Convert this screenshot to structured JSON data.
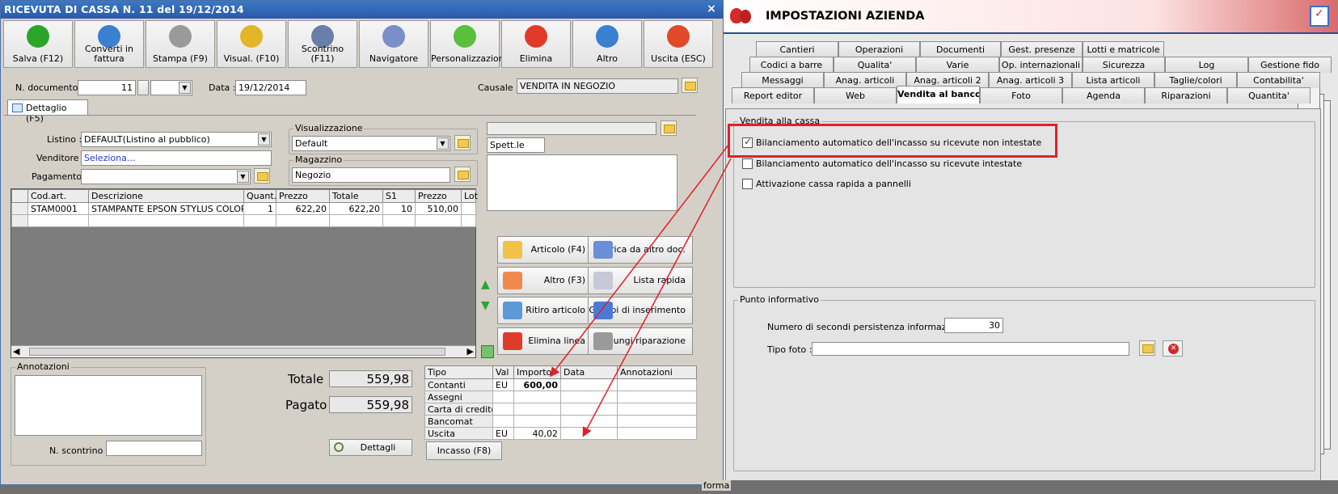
{
  "left_window": {
    "title": "RICEVUTA DI CASSA N. 11 del 19/12/2014",
    "close": "×",
    "toolbar": [
      {
        "label": "Salva (F12)",
        "icon": "check-icon",
        "color": "#2aa52a"
      },
      {
        "label": "Converti in fattura",
        "icon": "convert-icon",
        "color": "#3a7fd0"
      },
      {
        "label": "Stampa (F9)",
        "icon": "printer-icon",
        "color": "#9a9a9a"
      },
      {
        "label": "Visual. (F10)",
        "icon": "magic-wand-icon",
        "color": "#e4b528"
      },
      {
        "label": "Scontrino (F11)",
        "icon": "cash-register-icon",
        "color": "#6a7fa8"
      },
      {
        "label": "Navigatore",
        "icon": "compass-icon",
        "color": "#7a8fc8"
      },
      {
        "label": "Personalizzazioni",
        "icon": "puzzle-icon",
        "color": "#5abf3a"
      },
      {
        "label": "Elimina",
        "icon": "delete-icon",
        "color": "#e13a2a"
      },
      {
        "label": "Altro",
        "icon": "book-icon",
        "color": "#3a7fd0"
      },
      {
        "label": "Uscita (ESC)",
        "icon": "exit-icon",
        "color": "#e04a2a"
      }
    ],
    "n_documento_label": "N. documento :",
    "n_documento": "11",
    "data_label": "Data :",
    "data": "19/12/2014",
    "causale_label": "Causale :",
    "causale": "VENDITA IN NEGOZIO",
    "tab_dettaglio": "Dettaglio (F5)",
    "listino_label": "Listino :",
    "listino": "DEFAULT(Listino al pubblico)",
    "venditore_label": "Venditore :",
    "venditore": "Seleziona...",
    "pagamento_label": "Pagamento :",
    "visualizzazione_title": "Visualizzazione",
    "visualizzazione": "Default",
    "magazzino_title": "Magazzino",
    "magazzino": "Negozio",
    "spett": "Spett.le",
    "grid_headers": [
      "Cod.art.",
      "Descrizione",
      "Quant.",
      "Prezzo",
      "Totale",
      "S1",
      "Prezzo",
      "Lot"
    ],
    "grid_rows": [
      [
        "STAM0001",
        "STAMPANTE EPSON STYLUS COLOR C...",
        "1",
        "622,20",
        "622,20",
        "10",
        "510,00",
        ""
      ]
    ],
    "buttons": {
      "articolo": "Articolo (F4)",
      "carica": "Carica da altro doc.",
      "altro": "Altro (F3)",
      "lista": "Lista rapida",
      "ritiro": "Ritiro articolo",
      "gruppi": "Gruppi di inserimento",
      "elimina_linea": "Elimina linea",
      "aggiungi": "Aggiungi riparazione"
    },
    "annotazioni_title": "Annotazioni",
    "n_scontrino_label": "N. scontrino :",
    "totale_label": "Totale",
    "totale": "559,98",
    "pagato_label": "Pagato",
    "pagato": "559,98",
    "dettagli": "Dettagli",
    "pay_headers": [
      "Tipo",
      "Val",
      "Importo",
      "Data",
      "Annotazioni"
    ],
    "pay_rows": [
      [
        "Contanti",
        "EU",
        "600,00",
        "",
        ""
      ],
      [
        "Assegni",
        "",
        "",
        "",
        ""
      ],
      [
        "Carta di credito",
        "",
        "",
        "",
        ""
      ],
      [
        "Bancomat",
        "",
        "",
        "",
        ""
      ],
      [
        "Uscita",
        "EU",
        "40,02",
        "",
        ""
      ]
    ],
    "incasso": "Incasso (F8)"
  },
  "right_window": {
    "title": "IMPOSTAZIONI AZIENDA",
    "tabs_row1": [
      "Cantieri",
      "Operazioni",
      "Documenti",
      "Gest. presenze",
      "Lotti e matricole"
    ],
    "tabs_row2": [
      "Codici a barre",
      "Qualita'",
      "Varie",
      "Op. internazionali",
      "Sicurezza",
      "Log",
      "Gestione fido"
    ],
    "tabs_row3": [
      "Messaggi",
      "Anag. articoli",
      "Anag. articoli 2",
      "Anag. articoli 3",
      "Lista articoli",
      "Taglie/colori",
      "Contabilita'"
    ],
    "tabs_row4": [
      "Report editor",
      "Web",
      "Vendita al banco",
      "Foto",
      "Agenda",
      "Riparazioni",
      "Quantita'"
    ],
    "group1_title": "Vendita alla cassa",
    "opt1": "Bilanciamento automatico dell'incasso su ricevute non intestate",
    "opt2": "Bilanciamento automatico dell'incasso su ricevute intestate",
    "opt3": "Attivazione cassa rapida a pannelli",
    "group2_title": "Punto informativo",
    "secondi_label": "Numero di secondi persistenza informazioni :",
    "secondi": "30",
    "tipo_foto_label": "Tipo foto :",
    "bottom_text": "forma"
  }
}
